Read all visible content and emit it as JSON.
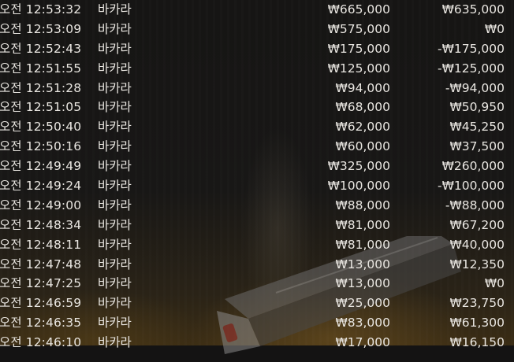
{
  "history": {
    "rows": [
      {
        "time": "오전 12:53:32",
        "game": "바카라",
        "bet": "₩665,000",
        "result": "₩635,000"
      },
      {
        "time": "오전 12:53:09",
        "game": "바카라",
        "bet": "₩575,000",
        "result": "₩0"
      },
      {
        "time": "오전 12:52:43",
        "game": "바카라",
        "bet": "₩175,000",
        "result": "-₩175,000"
      },
      {
        "time": "오전 12:51:55",
        "game": "바카라",
        "bet": "₩125,000",
        "result": "-₩125,000"
      },
      {
        "time": "오전 12:51:28",
        "game": "바카라",
        "bet": "₩94,000",
        "result": "-₩94,000"
      },
      {
        "time": "오전 12:51:05",
        "game": "바카라",
        "bet": "₩68,000",
        "result": "₩50,950"
      },
      {
        "time": "오전 12:50:40",
        "game": "바카라",
        "bet": "₩62,000",
        "result": "₩45,250"
      },
      {
        "time": "오전 12:50:16",
        "game": "바카라",
        "bet": "₩60,000",
        "result": "₩37,500"
      },
      {
        "time": "오전 12:49:49",
        "game": "바카라",
        "bet": "₩325,000",
        "result": "₩260,000"
      },
      {
        "time": "오전 12:49:24",
        "game": "바카라",
        "bet": "₩100,000",
        "result": "-₩100,000"
      },
      {
        "time": "오전 12:49:00",
        "game": "바카라",
        "bet": "₩88,000",
        "result": "-₩88,000"
      },
      {
        "time": "오전 12:48:34",
        "game": "바카라",
        "bet": "₩81,000",
        "result": "₩67,200"
      },
      {
        "time": "오전 12:48:11",
        "game": "바카라",
        "bet": "₩81,000",
        "result": "₩40,000"
      },
      {
        "time": "오전 12:47:48",
        "game": "바카라",
        "bet": "₩13,000",
        "result": "₩12,350"
      },
      {
        "time": "오전 12:47:25",
        "game": "바카라",
        "bet": "₩13,000",
        "result": "₩0"
      },
      {
        "time": "오전 12:46:59",
        "game": "바카라",
        "bet": "₩25,000",
        "result": "₩23,750"
      },
      {
        "time": "오전 12:46:35",
        "game": "바카라",
        "bet": "₩83,000",
        "result": "₩61,300"
      },
      {
        "time": "오전 12:46:10",
        "game": "바카라",
        "bet": "₩17,000",
        "result": "₩16,150"
      }
    ]
  }
}
